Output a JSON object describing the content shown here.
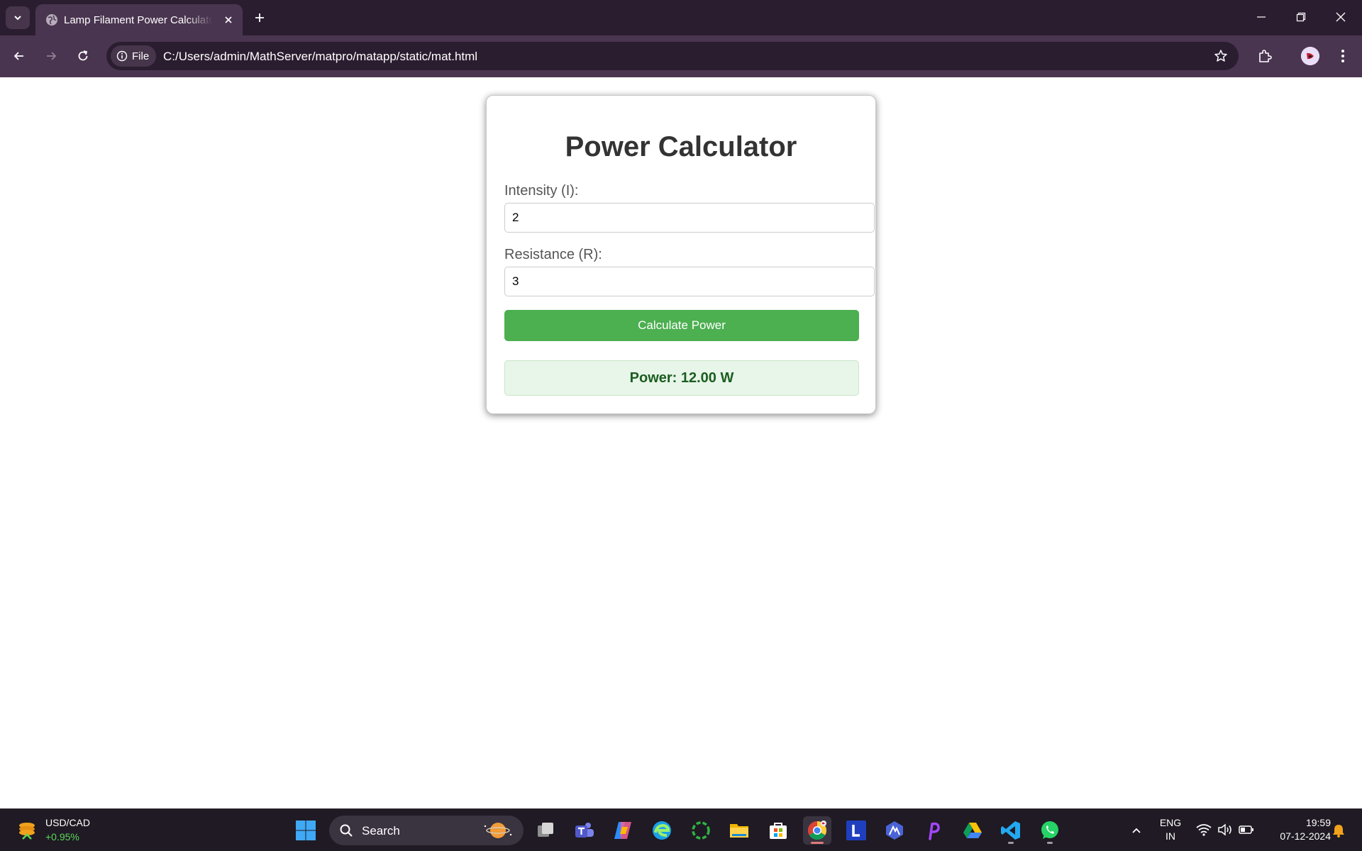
{
  "browser": {
    "tab_title": "Lamp Filament Power Calculator",
    "site_chip_label": "File",
    "url": "C:/Users/admin/MathServer/matpro/matapp/static/mat.html"
  },
  "page": {
    "title": "Power Calculator",
    "intensity_label": "Intensity (I):",
    "intensity_value": "2",
    "resistance_label": "Resistance (R):",
    "resistance_value": "3",
    "button_label": "Calculate Power",
    "result_text": "Power: 12.00 W"
  },
  "taskbar": {
    "widget_title": "USD/CAD",
    "widget_change": "+0.95%",
    "search_label": "Search",
    "language_line1": "ENG",
    "language_line2": "IN",
    "time": "19:59",
    "date": "07-12-2024"
  },
  "colors": {
    "tabstrip": "#2b1d30",
    "toolbar": "#4a3550",
    "button_green": "#4caf50",
    "result_bg": "#e8f5e9",
    "result_text": "#1b5e20"
  },
  "icons": {
    "browser": [
      "tab-search-icon",
      "globe-icon",
      "close-icon",
      "plus-icon",
      "minimize-icon",
      "restore-icon",
      "back-arrow-icon",
      "forward-arrow-icon",
      "reload-icon",
      "info-icon",
      "star-icon",
      "extensions-icon",
      "profile-avatar",
      "more-vert-icon"
    ],
    "taskbar": [
      "start-icon",
      "search-icon",
      "task-view-icon",
      "teams-icon",
      "copilot-icon",
      "edge-icon",
      "app-icon",
      "file-explorer-icon",
      "store-icon",
      "chrome-icon",
      "l-app-icon",
      "app-icon",
      "app-icon",
      "google-drive-icon",
      "vscode-icon",
      "whatsapp-icon",
      "chevron-up-icon",
      "wifi-icon",
      "volume-icon",
      "battery-icon",
      "notification-bell-icon"
    ]
  }
}
